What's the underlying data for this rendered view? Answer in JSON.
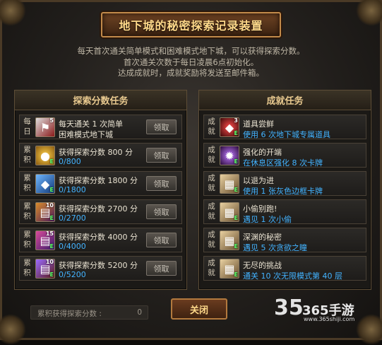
{
  "window": {
    "title": "地下城的秘密探索记录装置",
    "intro_lines": [
      "每天首次通关简单模式和困难模式地下城，可以获得探索分数。",
      "首次通关次数于每日凌晨6点初始化。",
      "达成成就时，成就奖励将发送至邮件箱。"
    ]
  },
  "tasks": {
    "header": "探索分数任务",
    "claim_label": "领取",
    "rows": [
      {
        "tag": "每日",
        "icon": "dungeon-flag-icon",
        "icon_count": "5",
        "line1": "每天通关 1 次简单",
        "line2": "困难模式地下城",
        "progress": false
      },
      {
        "tag": "累积",
        "icon": "gold-jar-icon",
        "icon_count": "",
        "line1": "获得探索分数 800 分",
        "line2": "0/800",
        "progress": true
      },
      {
        "tag": "累积",
        "icon": "blue-box-icon",
        "icon_count": "",
        "line1": "获得探索分数 1800 分",
        "line2": "0/1800",
        "progress": true
      },
      {
        "tag": "累积",
        "icon": "scroll-bundle-icon",
        "icon_count": "10",
        "line1": "获得探索分数 2700 分",
        "line2": "0/2700",
        "progress": true
      },
      {
        "tag": "累积",
        "icon": "purple-scroll-icon",
        "icon_count": "15",
        "line1": "获得探索分数 4000 分",
        "line2": "0/4000",
        "progress": true
      },
      {
        "tag": "累积",
        "icon": "rare-scroll-icon",
        "icon_count": "10",
        "line1": "获得探索分数 5200 分",
        "line2": "0/5200",
        "progress": true
      }
    ]
  },
  "achievements": {
    "header": "成就任务",
    "rows": [
      {
        "tag": "成就",
        "icon": "red-gem-icon",
        "icon_count": "3",
        "title": "道具尝鲜",
        "desc": "使用 6 次地下城专属道具"
      },
      {
        "tag": "成就",
        "icon": "purple-orb-icon",
        "icon_count": "",
        "title": "强化的开端",
        "desc": "在休息区强化 8 次卡牌"
      },
      {
        "tag": "成就",
        "icon": "card-pack-icon",
        "icon_count": "",
        "title": "以退为进",
        "desc": "使用 1 张灰色边框卡牌"
      },
      {
        "tag": "成就",
        "icon": "card-pack-icon",
        "icon_count": "",
        "title": "小偷别跑!",
        "desc": "遇见 1 次小偷"
      },
      {
        "tag": "成就",
        "icon": "card-pack-icon",
        "icon_count": "",
        "title": "深渊的秘密",
        "desc": "遇见 5 次贪欲之瞳"
      },
      {
        "tag": "成就",
        "icon": "card-pack-icon",
        "icon_count": "",
        "title": "无尽的挑战",
        "desc": "通关 10 次无限模式第 40 层"
      }
    ]
  },
  "footer": {
    "total_label": "累积获得探索分数 :",
    "total_value": "0",
    "close_label": "关闭"
  },
  "watermark": {
    "logo": "35",
    "name": "365手游",
    "url": "www.365shiji.com"
  },
  "colors": {
    "accent_gold": "#ffd98a",
    "progress_blue": "#43b3ff",
    "frame_bronze": "#b37a3e"
  }
}
